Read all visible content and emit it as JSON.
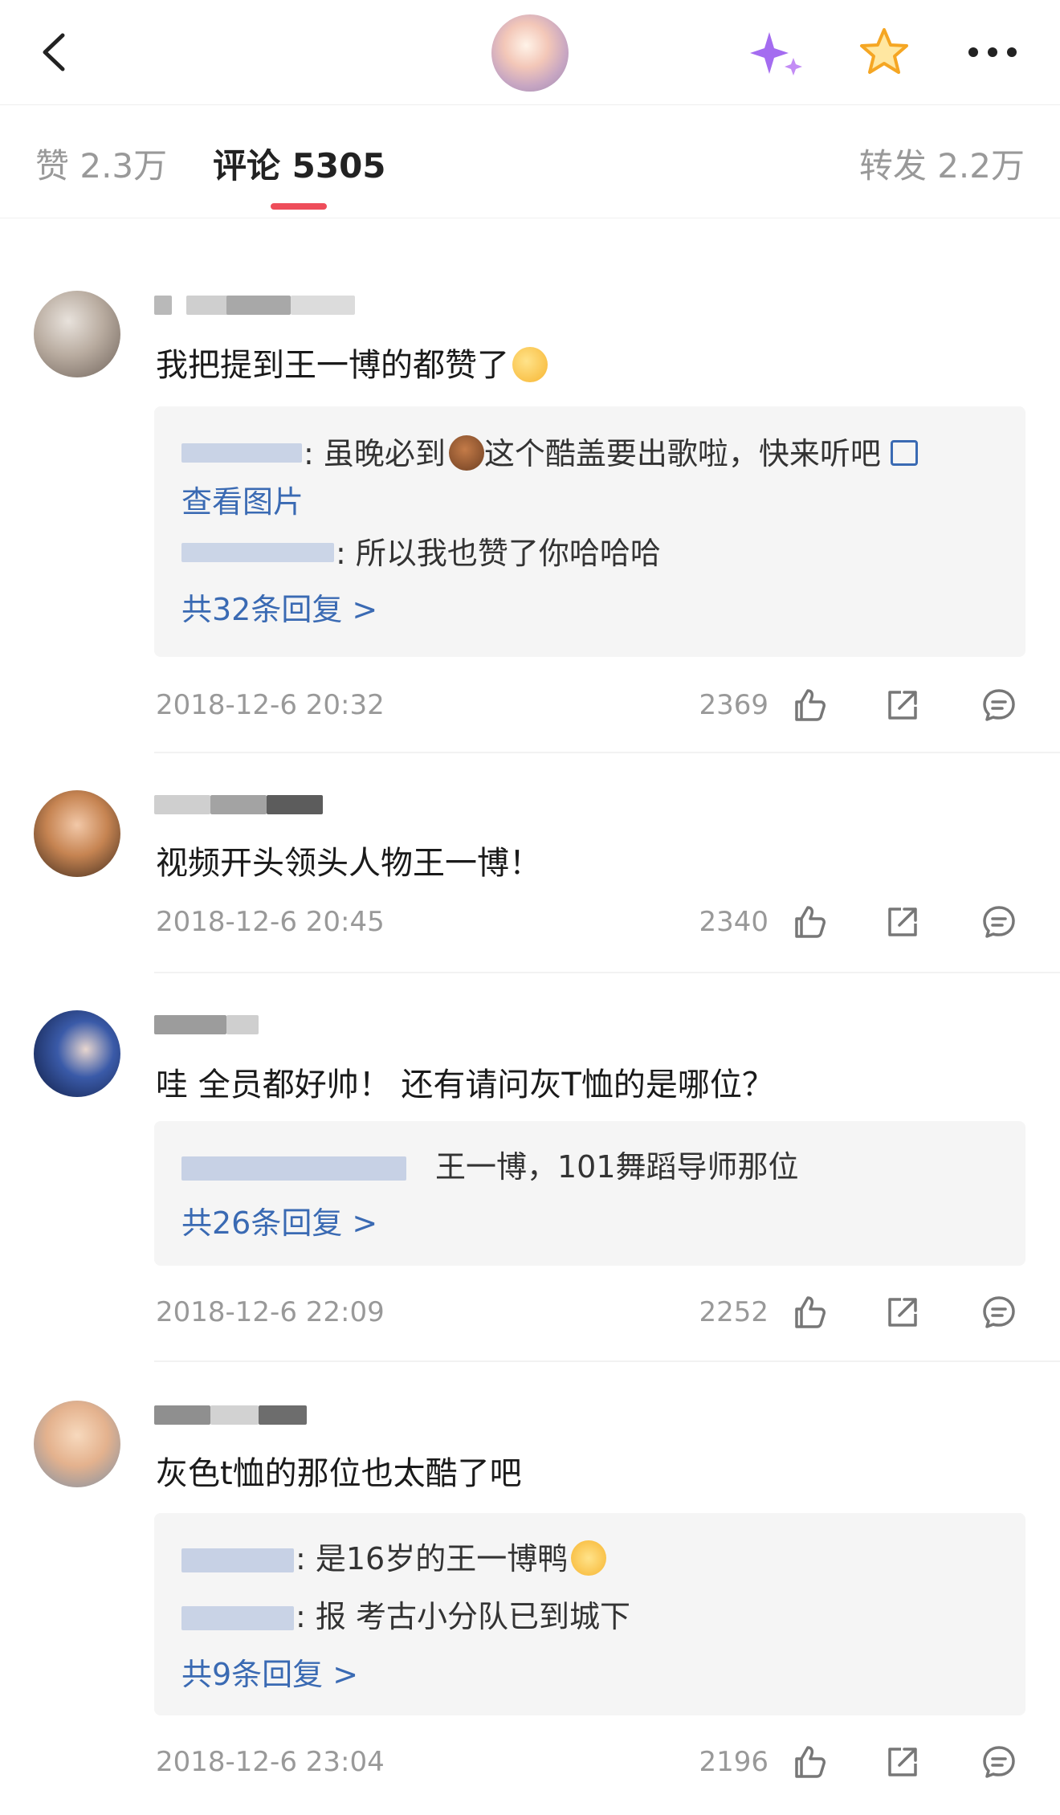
{
  "header": {
    "back_icon": "back-chevron-icon",
    "ai_icon": "sparkle-icon",
    "fav_icon": "star-icon",
    "more_icon": "more-dots-icon"
  },
  "tabs": {
    "likes": "赞 2.3万",
    "comments": "评论 5305",
    "reposts": "转发 2.2万",
    "accent": "#ee4d5a"
  },
  "comments": [
    {
      "text": "我把提到王一博的都赞了",
      "replies": [
        {
          "text": ": 虽晚必到",
          "text2": "这个酷盖要出歌啦，快来听吧"
        },
        {
          "text": ": 所以我也赞了你哈哈哈"
        }
      ],
      "view_image": "查看图片",
      "more": "共32条回复 >",
      "time": "2018-12-6 20:32",
      "likes": "2369"
    },
    {
      "text": "视频开头领头人物王一博！",
      "time": "2018-12-6 20:45",
      "likes": "2340"
    },
    {
      "text": "哇 全员都好帅！ 还有请问灰T恤的是哪位？",
      "replies": [
        {
          "text": "王一博，101舞蹈导师那位"
        }
      ],
      "more": "共26条回复 >",
      "time": "2018-12-6 22:09",
      "likes": "2252"
    },
    {
      "text": "灰色t恤的那位也太酷了吧",
      "replies": [
        {
          "text": ": 是16岁的王一博鸭"
        },
        {
          "text": ": 报  考古小分队已到城下"
        }
      ],
      "more": "共9条回复 >",
      "time": "2018-12-6 23:04",
      "likes": "2196"
    }
  ]
}
